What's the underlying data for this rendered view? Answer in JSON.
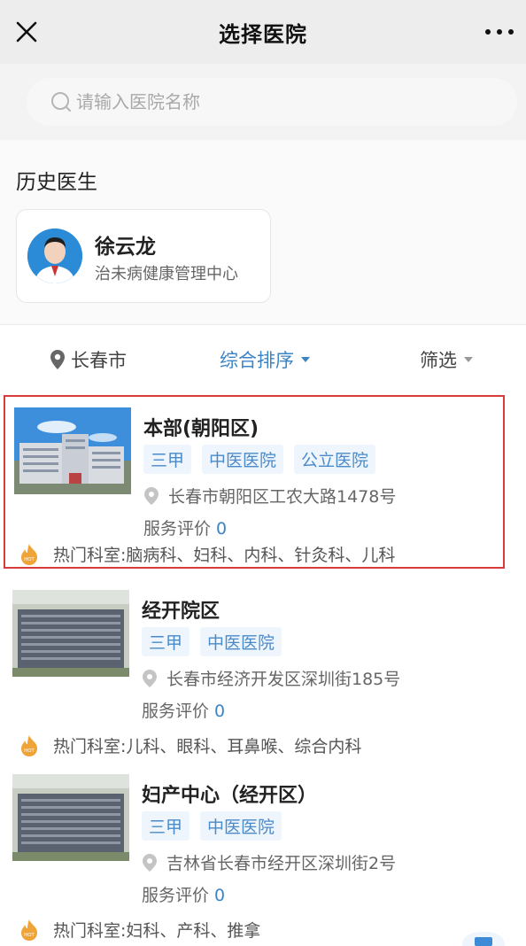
{
  "header": {
    "title": "选择医院"
  },
  "search": {
    "placeholder": "请输入医院名称"
  },
  "history": {
    "title": "历史医生",
    "doctor": {
      "name": "徐云龙",
      "org": "治未病健康管理中心"
    }
  },
  "filters": {
    "city": "长春市",
    "sort": "综合排序",
    "screen": "筛选"
  },
  "hospitals": [
    {
      "name": "本部(朝阳区)",
      "tags": [
        "三甲",
        "中医医院",
        "公立医院"
      ],
      "address": "长春市朝阳区工农大路1478号",
      "rating_label": "服务评价",
      "rating_value": "0",
      "depts_label": "热门科室:",
      "depts": "脑病科、妇科、内科、针灸科、儿科",
      "selected": true
    },
    {
      "name": "经开院区",
      "tags": [
        "三甲",
        "中医医院"
      ],
      "address": "长春市经济开发区深圳街185号",
      "rating_label": "服务评价",
      "rating_value": "0",
      "depts_label": "热门科室:",
      "depts": "儿科、眼科、耳鼻喉、综合内科",
      "selected": false
    },
    {
      "name": "妇产中心（经开区）",
      "tags": [
        "三甲",
        "中医医院"
      ],
      "address": "吉林省长春市经开区深圳街2号",
      "rating_label": "服务评价",
      "rating_value": "0",
      "depts_label": "热门科室:",
      "depts": "妇科、产科、推拿",
      "selected": false
    }
  ],
  "colors": {
    "accent": "#3d84c4",
    "tag_bg": "#eef5fc",
    "highlight": "#d93a3a"
  },
  "icons": [
    "close-icon",
    "more-icon",
    "search-icon",
    "location-pin-icon",
    "caret-down-icon",
    "fire-hot-icon"
  ]
}
